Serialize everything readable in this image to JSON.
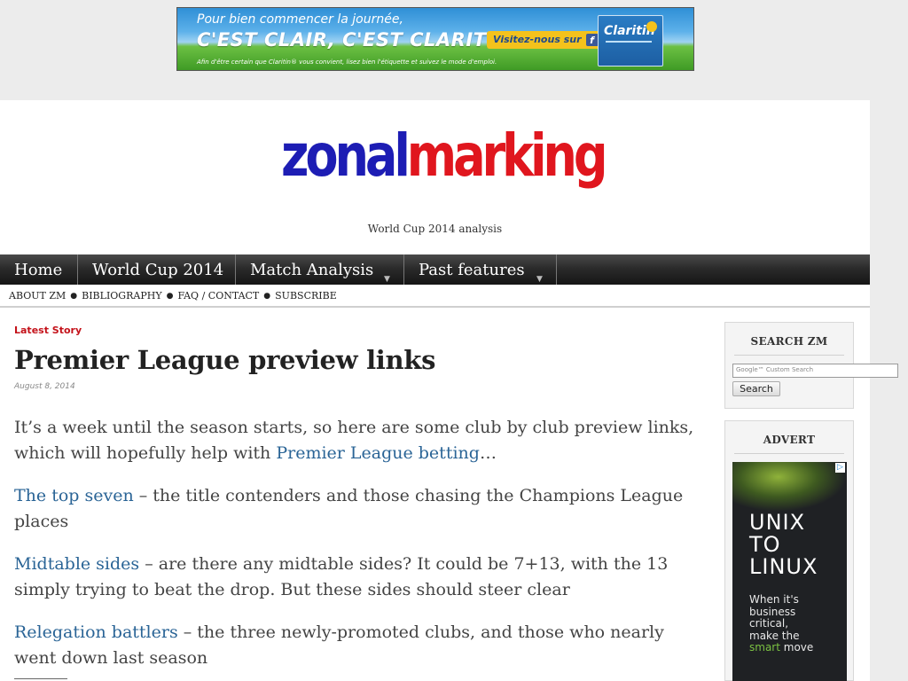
{
  "banner_ad": {
    "line1": "Pour bien commencer la journée,",
    "headline": "C'EST CLAIR, C'EST CLARITIN.",
    "cta": "Visitez-nous sur",
    "fine_print": "Afin d'être certain que Claritin® vous convient, lisez bien l'étiquette et suivez le mode d'emploi.",
    "product": "Claritin"
  },
  "header": {
    "logo_part1": "zonal",
    "logo_part2": "marking",
    "tagline": "World Cup 2014 analysis"
  },
  "nav": {
    "items": [
      "Home",
      "World Cup 2014",
      "Match Analysis",
      "Past features"
    ]
  },
  "subnav": {
    "items": [
      "ABOUT ZM",
      "BIBLIOGRAPHY",
      "FAQ / CONTACT",
      "SUBSCRIBE"
    ]
  },
  "article": {
    "kicker": "Latest Story",
    "title": "Premier League preview links",
    "date": "August 8, 2014",
    "p1_text": "It’s a week until the season starts, so here are some club by club preview links, which will hopefully help with ",
    "p1_link": "Premier League betting",
    "p1_tail": "…",
    "p2_link": "The top seven",
    "p2_text": " – the title contenders and those chasing the Champions League places",
    "p3_link": "Midtable sides",
    "p3_text": " – are there any midtable sides? It could be 7+13, with the 13 simply trying to beat the drop. But these sides should steer clear",
    "p4_link": "Relegation battlers",
    "p4_text": " – the three newly-promoted clubs, and those who nearly went down last season"
  },
  "sidebar": {
    "search_title": "SEARCH ZM",
    "search_placeholder": "Google™ Custom Search",
    "search_button": "Search",
    "advert_title": "ADVERT",
    "ad_line1": "UNIX",
    "ad_line2": "TO",
    "ad_line3": "LINUX",
    "ad_body1": "When it's",
    "ad_body2": "business",
    "ad_body3": "critical,",
    "ad_body4": "make the",
    "ad_body5a": "smart",
    "ad_body5b": " move"
  },
  "colors": {
    "logo_blue": "#1d1db4",
    "logo_red": "#e0161e",
    "link": "#2a6496",
    "kicker_red": "#c4121a"
  }
}
